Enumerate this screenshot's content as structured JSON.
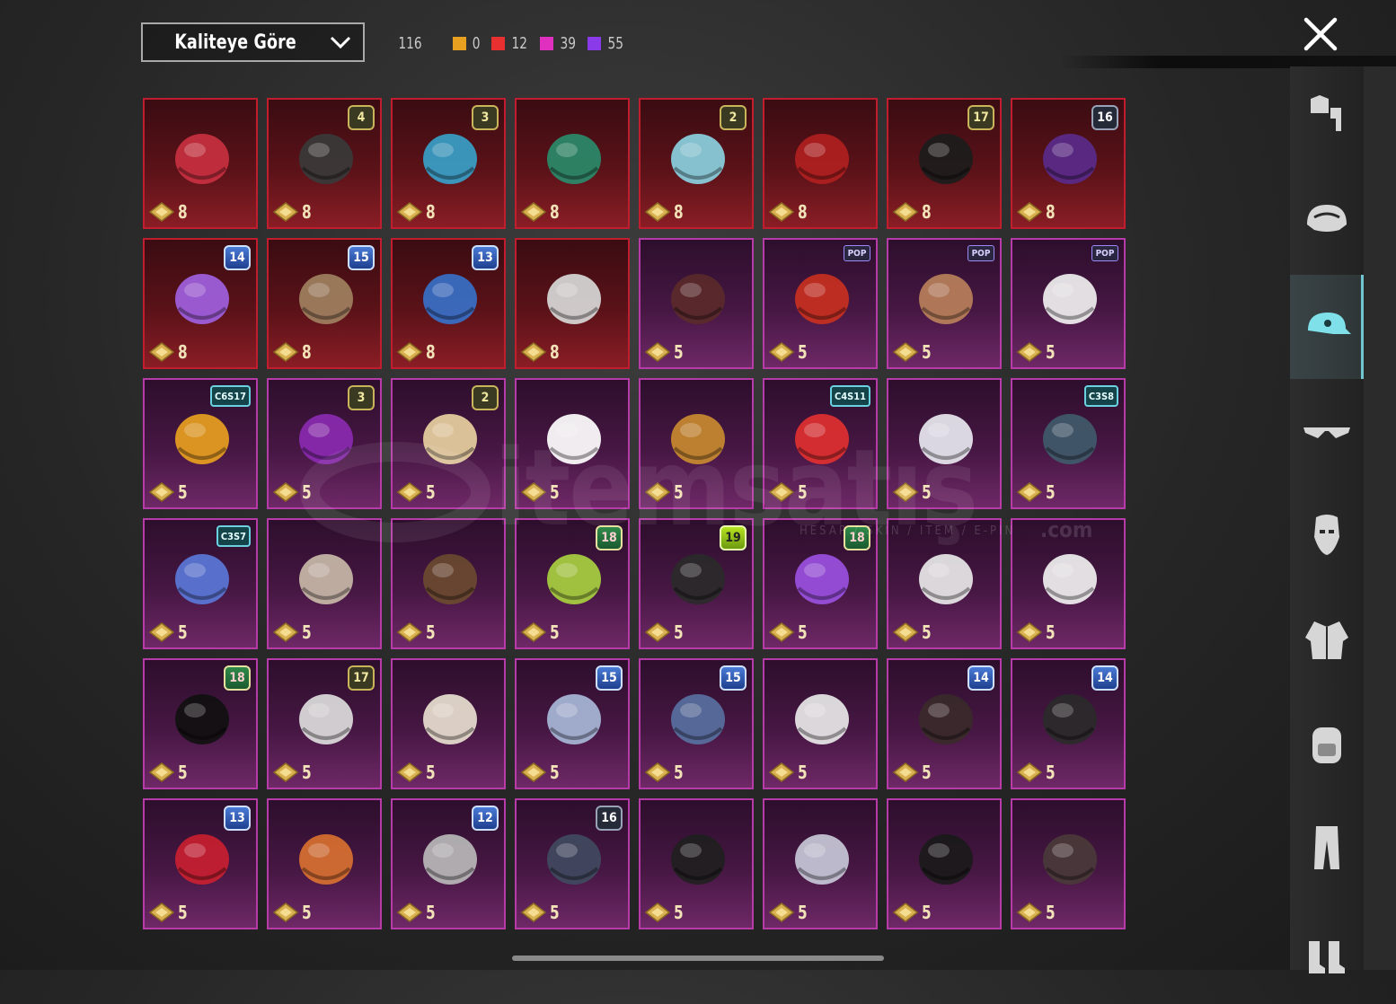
{
  "sort": {
    "label": "Kaliteye Göre"
  },
  "stats": {
    "total": "116",
    "counts": [
      {
        "value": "0",
        "color": "#e8a020"
      },
      {
        "value": "12",
        "color": "#e83030"
      },
      {
        "value": "39",
        "color": "#e030c0"
      },
      {
        "value": "55",
        "color": "#8a3ae8"
      }
    ]
  },
  "watermark": {
    "main": "itemsatış",
    "sub": "HESAP / SKIN / ITEM / E-PIN",
    "domain": ".com"
  },
  "items": [
    {
      "score": "8",
      "quality": "red",
      "badge": "",
      "icon": "red-helmet-icon"
    },
    {
      "score": "8",
      "quality": "red",
      "badge": "4",
      "icon": "tophat-snowman-icon"
    },
    {
      "score": "8",
      "quality": "red",
      "badge": "3",
      "icon": "joker-mask-icon"
    },
    {
      "score": "8",
      "quality": "red",
      "badge": "",
      "icon": "dragon-crest-helmet-icon"
    },
    {
      "score": "8",
      "quality": "red",
      "badge": "2",
      "icon": "ice-hood-icon"
    },
    {
      "score": "8",
      "quality": "red",
      "badge": "",
      "icon": "horned-mecha-helmet-icon"
    },
    {
      "score": "8",
      "quality": "red",
      "badge": "17",
      "icon": "gold-braid-helmet-icon"
    },
    {
      "score": "8",
      "quality": "red",
      "badge": "16",
      "icon": "purple-mecha-helmet-icon"
    },
    {
      "score": "8",
      "quality": "red",
      "badge": "14",
      "icon": "purple-flame-helmet-icon"
    },
    {
      "score": "8",
      "quality": "red",
      "badge": "15",
      "icon": "gold-crest-helmet-icon"
    },
    {
      "score": "8",
      "quality": "red",
      "badge": "13",
      "icon": "blue-visor-helmet-icon"
    },
    {
      "score": "8",
      "quality": "red",
      "badge": "",
      "icon": "astronaut-helmet-icon"
    },
    {
      "score": "5",
      "quality": "mag",
      "badge": "",
      "icon": "hair-icon"
    },
    {
      "score": "5",
      "quality": "mag",
      "badge": "POP",
      "icon": "cap-goggles-icon"
    },
    {
      "score": "5",
      "quality": "mag",
      "badge": "POP",
      "icon": "llama-mask-icon"
    },
    {
      "score": "5",
      "quality": "mag",
      "badge": "POP",
      "icon": "panda-mask-icon"
    },
    {
      "score": "5",
      "quality": "mag",
      "badge": "C6S17",
      "icon": "visor-fur-icon"
    },
    {
      "score": "5",
      "quality": "mag",
      "badge": "3",
      "icon": "jester-hat-icon"
    },
    {
      "score": "5",
      "quality": "mag",
      "badge": "2",
      "icon": "sailor-hair-icon"
    },
    {
      "score": "5",
      "quality": "mag",
      "badge": "",
      "icon": "seagull-mask-icon"
    },
    {
      "score": "5",
      "quality": "mag",
      "badge": "",
      "icon": "potato-mask-icon"
    },
    {
      "score": "5",
      "quality": "mag",
      "badge": "C4S11",
      "icon": "red-cap-icon"
    },
    {
      "score": "5",
      "quality": "mag",
      "badge": "",
      "icon": "feather-hat-icon"
    },
    {
      "score": "5",
      "quality": "mag",
      "badge": "C3S8",
      "icon": "bandana-icon"
    },
    {
      "score": "5",
      "quality": "mag",
      "badge": "C3S7",
      "icon": "blue-feather-icon"
    },
    {
      "score": "5",
      "quality": "mag",
      "badge": "",
      "icon": "eagle-mask-icon"
    },
    {
      "score": "5",
      "quality": "mag",
      "badge": "",
      "icon": "cowboy-hat-icon"
    },
    {
      "score": "5",
      "quality": "mag",
      "badge": "18",
      "icon": "green-claw-icon"
    },
    {
      "score": "5",
      "quality": "mag",
      "badge": "19",
      "icon": "bug-mask-icon"
    },
    {
      "score": "5",
      "quality": "mag",
      "badge": "18",
      "icon": "purple-dj-cap-icon"
    },
    {
      "score": "5",
      "quality": "mag",
      "badge": "",
      "icon": "santa-rooster-icon"
    },
    {
      "score": "5",
      "quality": "mag",
      "badge": "",
      "icon": "officer-cap-icon"
    },
    {
      "score": "5",
      "quality": "mag",
      "badge": "18",
      "icon": "headphone-cap-icon"
    },
    {
      "score": "5",
      "quality": "mag",
      "badge": "17",
      "icon": "white-mask-icon"
    },
    {
      "score": "5",
      "quality": "mag",
      "badge": "",
      "icon": "lion-mask-icon"
    },
    {
      "score": "5",
      "quality": "mag",
      "badge": "15",
      "icon": "knight-helmet-icon"
    },
    {
      "score": "5",
      "quality": "mag",
      "badge": "15",
      "icon": "robot-helmet-icon"
    },
    {
      "score": "5",
      "quality": "mag",
      "badge": "",
      "icon": "zebra-mask-icon"
    },
    {
      "score": "5",
      "quality": "mag",
      "badge": "14",
      "icon": "peaked-cap-icon"
    },
    {
      "score": "5",
      "quality": "mag",
      "badge": "14",
      "icon": "studded-cap-icon"
    },
    {
      "score": "5",
      "quality": "mag",
      "badge": "13",
      "icon": "samurai-helmet-icon"
    },
    {
      "score": "5",
      "quality": "mag",
      "badge": "",
      "icon": "frog-hat-icon"
    },
    {
      "score": "5",
      "quality": "mag",
      "badge": "12",
      "icon": "gas-mask-icon"
    },
    {
      "score": "5",
      "quality": "mag",
      "badge": "16",
      "icon": "tactical-helmet-icon"
    },
    {
      "score": "5",
      "quality": "mag",
      "badge": "",
      "icon": "orange-visor-helmet-icon"
    },
    {
      "score": "5",
      "quality": "mag",
      "badge": "",
      "icon": "moto-helmet-icon"
    },
    {
      "score": "5",
      "quality": "mag",
      "badge": "",
      "icon": "tricorn-hat-icon"
    },
    {
      "score": "5",
      "quality": "mag",
      "badge": "",
      "icon": "headband-icon"
    }
  ],
  "sidebar": [
    {
      "icon": "outfit-icon",
      "active": false
    },
    {
      "icon": "helmet-icon",
      "active": false
    },
    {
      "icon": "cap-icon",
      "active": true
    },
    {
      "icon": "glasses-icon",
      "active": false
    },
    {
      "icon": "mask-icon",
      "active": false
    },
    {
      "icon": "jacket-icon",
      "active": false
    },
    {
      "icon": "backpack-icon",
      "active": false
    },
    {
      "icon": "pants-icon",
      "active": false
    },
    {
      "icon": "boots-icon",
      "active": false
    }
  ]
}
